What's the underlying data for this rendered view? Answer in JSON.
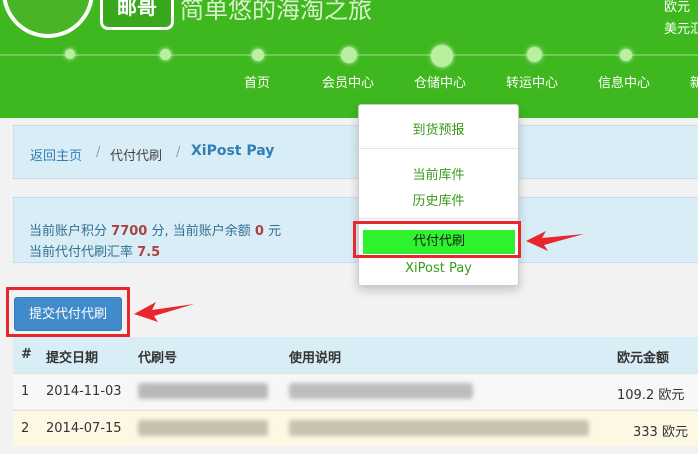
{
  "header": {
    "logo_text": "邮哥",
    "slogan": "简单悠的海淘之旅",
    "top_right_1": "欧元",
    "top_right_2": "美元汇"
  },
  "nav": {
    "items": [
      "首页",
      "会员中心",
      "仓储中心",
      "转运中心",
      "信息中心",
      "新"
    ]
  },
  "dropdown": {
    "items": [
      "到货预报",
      "当前库件",
      "历史库件",
      "代付代刷",
      "XiPost Pay"
    ]
  },
  "breadcrumb": {
    "home": "返回主页",
    "sep": "/",
    "middle": "代付代刷",
    "current": "XiPost Pay"
  },
  "info": {
    "points_label": "当前账户积分",
    "points_value": "7700",
    "points_unit": "分, 当前账户余额",
    "balance_value": "0",
    "balance_unit": "元",
    "rate_label": "当前代付代刷汇率",
    "rate_value": "7.5"
  },
  "submit_button": "提交代付代刷",
  "table": {
    "headers": [
      "#",
      "提交日期",
      "代刷号",
      "使用说明",
      "欧元金额"
    ],
    "rows": [
      {
        "num": "1",
        "date": "2014-11-03",
        "amount": "109.2 欧元"
      },
      {
        "num": "2",
        "date": "2014-07-15",
        "amount": "333 欧元"
      }
    ]
  },
  "colors": {
    "header_green": "#3fb81f",
    "highlight_red": "#e8262b",
    "link_blue": "#2f7fb5",
    "active_green": "#2ef22e"
  }
}
